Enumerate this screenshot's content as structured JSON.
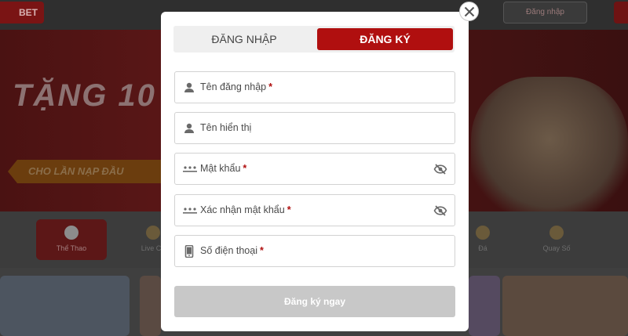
{
  "background": {
    "logo_text": "BET",
    "login_label": "Đăng nhập",
    "banner_title": "TẶNG 10",
    "banner_sub": "CHO LẦN NẠP ĐẦU",
    "categories": [
      {
        "label": "Thể Thao",
        "active": true
      },
      {
        "label": "Live Ca",
        "active": false
      },
      {
        "label": "Đá",
        "active": false
      },
      {
        "label": "Quay Số",
        "active": false
      }
    ]
  },
  "modal": {
    "tabs": {
      "login": "ĐĂNG NHẬP",
      "register": "ĐĂNG KÝ",
      "active": "register"
    },
    "fields": [
      {
        "icon": "user-icon",
        "label": "Tên đăng nhập",
        "required": "*",
        "has_eye": false
      },
      {
        "icon": "user-icon",
        "label": "Tên hiển thị",
        "required": "",
        "has_eye": false
      },
      {
        "icon": "password-dots-icon",
        "label": "Mật khẩu",
        "required": "*",
        "has_eye": true
      },
      {
        "icon": "password-dots-icon",
        "label": "Xác nhận mật khẩu",
        "required": "*",
        "has_eye": true
      },
      {
        "icon": "phone-icon",
        "label": "Số điện thoại",
        "required": "*",
        "has_eye": false
      }
    ],
    "submit_label": "Đăng ký ngay",
    "submit_disabled": true,
    "colors": {
      "accent": "#b00f0f",
      "disabled": "#c8c8c8",
      "border": "#d2d2d2"
    }
  }
}
